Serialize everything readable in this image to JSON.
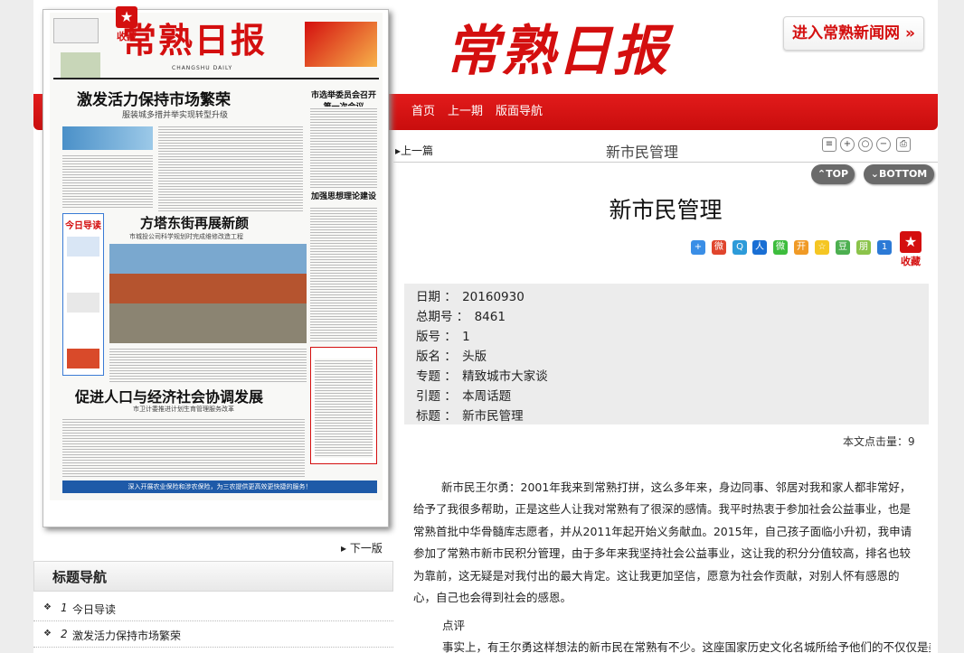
{
  "header": {
    "logo": "常熟日报",
    "enter_button": "进入常熟新闻网",
    "nav": [
      "首页",
      "上一期",
      "版面导航"
    ]
  },
  "paper": {
    "masthead": "常熟日报",
    "masthead_sub": "CHANGSHU DAILY",
    "headline1": "激发活力保持市场繁荣",
    "subhead1": "服装城多措并举实现转型升级",
    "headline2": "方塔东街再展新颜",
    "subhead2": "市城投公司科学规划时完成维修改造工程",
    "headline3": "促进人口与经济社会协调发展",
    "subhead3": "市卫计委推进计划生育管理服务改革",
    "side_headline1": "市选举委员会召开第一次会议",
    "side_headline2": "加强思想理论建设",
    "today_guide": "今日导读",
    "bottom_banner": "深入开展农业保险和涉农保险，为三农提供更高效更快捷的服务！",
    "collect_label": "收藏",
    "next_page": "下一版"
  },
  "title_nav": {
    "heading": "标题导航",
    "items": [
      {
        "num": "1",
        "title": "今日导读"
      },
      {
        "num": "2",
        "title": "激发活力保持市场繁荣"
      }
    ]
  },
  "article": {
    "prev_link": "上一篇",
    "bar_title": "新市民管理",
    "top_button": "TOP",
    "bottom_button": "BOTTOM",
    "title": "新市民管理",
    "collect_label": "收藏",
    "meta": [
      {
        "key": "日期",
        "value": "20160930"
      },
      {
        "key": "总期号",
        "value": "8461"
      },
      {
        "key": "版号",
        "value": "1"
      },
      {
        "key": "版名",
        "value": "头版"
      },
      {
        "key": "专题",
        "value": "精致城市大家谈"
      },
      {
        "key": "引题",
        "value": "本周话题"
      },
      {
        "key": "标题",
        "value": "新市民管理"
      }
    ],
    "hits_label": "本文点击量：",
    "hits_value": "9",
    "body": "新市民王尔勇：2001年我来到常熟打拼，这么多年来，身边同事、邻居对我和家人都非常好，给予了我很多帮助，正是这些人让我对常熟有了很深的感情。我平时热衷于参加社会公益事业，也是常熟首批中华骨髓库志愿者，并从2011年起开始义务献血。2015年，自己孩子面临小升初，我申请参加了常熟市新市民积分管理，由于多年来我坚持社会公益事业，这让我的积分分值较高，排名也较为靠前，这无疑是对我付出的最大肯定。这让我更加坚信，愿意为社会作贡献，对别人怀有感恩的心，自己也会得到社会的感恩。",
    "comment_label": "点评",
    "body2": "事实上，有王尔勇这样想法的新市民在常熟有不少。这座国家历史文化名城所给予他们的不仅仅是美"
  },
  "colors": {
    "brand_red": "#d40f0f",
    "meta_bg": "#ececec"
  }
}
